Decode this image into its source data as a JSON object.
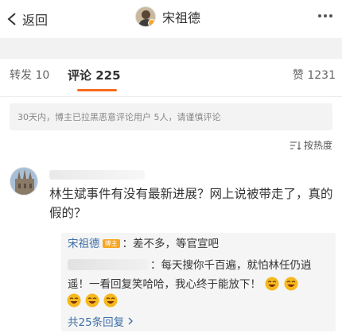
{
  "nav": {
    "back_label": "返回",
    "title": "宋祖德"
  },
  "tabs": {
    "repost": "转发 10",
    "comment": "评论 225",
    "like": "赞 1231",
    "accent": "#f76b1c"
  },
  "notice": "30天内，博主已拉黑恶意评论用户 5人，请谨慎评论",
  "sort": {
    "label": "按热度"
  },
  "comment": {
    "text": "林生斌事件有没有最新进展？网上说被带走了，真的假的？",
    "replies": [
      {
        "author": "宋祖德",
        "tag": "博主",
        "colon": "：",
        "text": "差不多，等官宣吧"
      },
      {
        "text": "：每天搜你千百遍，就怕林任仍逍遥！一看回复笑哈哈，我心终于能放下！"
      }
    ],
    "more_replies": "共25条回复"
  },
  "colors": {
    "link": "#3f6fa8",
    "badge": "#f7a623",
    "notice_bg": "#f3f3f3",
    "reply_bg": "#f5f5f5"
  },
  "icons": [
    "chevron-left-icon",
    "more-dots-icon",
    "sort-icon",
    "laughing-emoji-icon",
    "chevron-right-icon"
  ]
}
